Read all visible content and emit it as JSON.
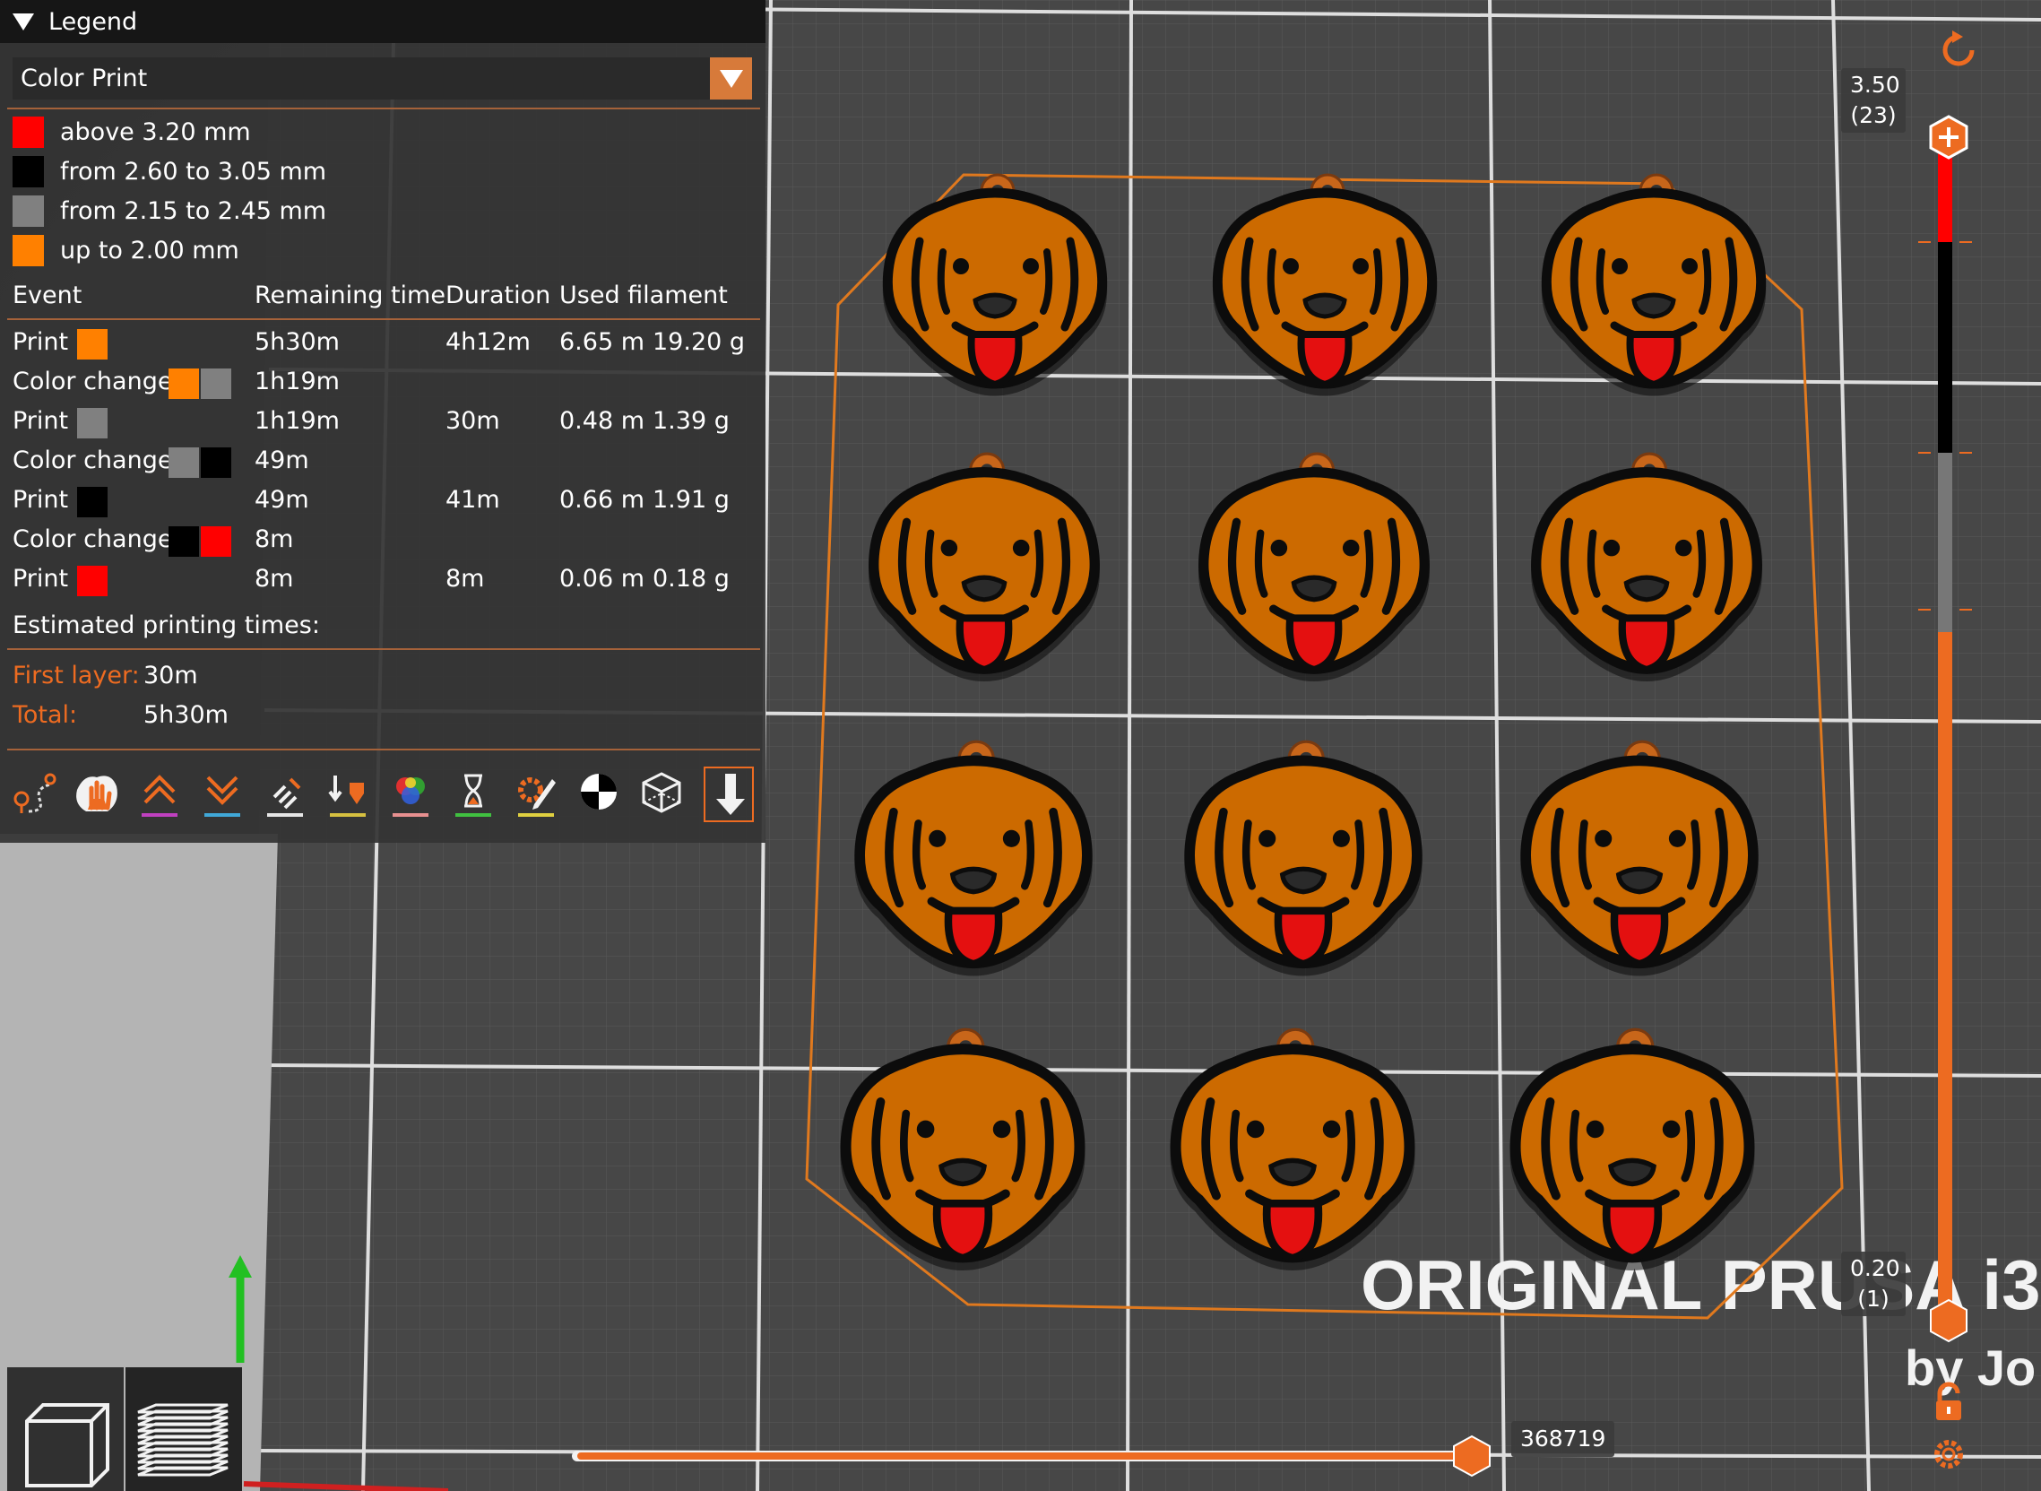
{
  "legend": {
    "title": "Legend",
    "mode": "Color Print",
    "ranges": [
      {
        "color": "#ff0000",
        "label": "above 3.20 mm"
      },
      {
        "color": "#000000",
        "label": "from 2.60 to 3.05 mm"
      },
      {
        "color": "#808080",
        "label": "from 2.15 to 2.45 mm"
      },
      {
        "color": "#ff8000",
        "label": "up to 2.00 mm"
      }
    ],
    "columns": {
      "event": "Event",
      "remaining": "Remaining time",
      "duration": "Duration",
      "filament": "Used filament"
    },
    "rows": [
      {
        "event": "Print",
        "colors": [
          "#ff8000"
        ],
        "remaining": "5h30m",
        "duration": "4h12m",
        "meters": "6.65 m",
        "grams": "19.20 g"
      },
      {
        "event": "Color change",
        "colors": [
          "#ff8000",
          "#808080"
        ],
        "remaining": "1h19m",
        "duration": "",
        "meters": "",
        "grams": ""
      },
      {
        "event": "Print",
        "colors": [
          "#808080"
        ],
        "remaining": "1h19m",
        "duration": "30m",
        "meters": "0.48 m",
        "grams": "1.39 g"
      },
      {
        "event": "Color change",
        "colors": [
          "#808080",
          "#000000"
        ],
        "remaining": "49m",
        "duration": "",
        "meters": "",
        "grams": ""
      },
      {
        "event": "Print",
        "colors": [
          "#000000"
        ],
        "remaining": "49m",
        "duration": "41m",
        "meters": "0.66 m",
        "grams": "1.91 g"
      },
      {
        "event": "Color change",
        "colors": [
          "#000000",
          "#ff0000"
        ],
        "remaining": "8m",
        "duration": "",
        "meters": "",
        "grams": ""
      },
      {
        "event": "Print",
        "colors": [
          "#ff0000"
        ],
        "remaining": "8m",
        "duration": "8m",
        "meters": "0.06 m",
        "grams": "0.18 g"
      }
    ],
    "estimated_label": "Estimated printing times:",
    "first_layer_label": "First layer:",
    "first_layer_value": "30m",
    "total_label": "Total:",
    "total_value": "5h30m",
    "toolbar_icons": [
      "travel-icon",
      "retractions-icon",
      "deretractions-icon",
      "seams-icon",
      "wipes-icon",
      "tool-changes-icon",
      "color-changes-icon",
      "pause-prints-icon",
      "custom-gcodes-icon",
      "center-of-gravity-icon",
      "shells-icon",
      "tool-marker-icon"
    ]
  },
  "vertical_slider": {
    "top_height": "3.50",
    "top_layer": "(23)",
    "bottom_height": "0.20",
    "bottom_layer": "(1)"
  },
  "horizontal_slider": {
    "value": "368719"
  },
  "bed_text": {
    "line1": "ORIGINAL PRUSA i3",
    "line2": "by Jo"
  },
  "colors": {
    "accent": "#ed6b21",
    "panel": "#343434",
    "orange_filament": "#cc6a00"
  }
}
